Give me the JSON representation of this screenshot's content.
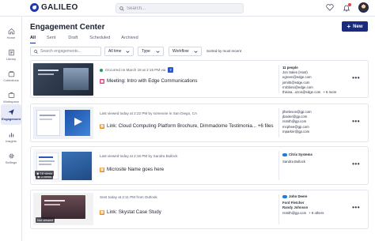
{
  "app": {
    "name": "GALILEO"
  },
  "search": {
    "placeholder": "Search..."
  },
  "page": {
    "title": "Engagement Center",
    "new_button": "New"
  },
  "tabs": [
    "All",
    "Sent",
    "Draft",
    "Scheduled",
    "Archived"
  ],
  "filters": {
    "search_placeholder": "Search engagements...",
    "time": "All time",
    "type": "Type",
    "workflow": "Workflow",
    "sort": "Sorted by most recent"
  },
  "sidebar": {
    "items": [
      {
        "label": "Home",
        "icon": "home-icon"
      },
      {
        "label": "Library",
        "icon": "library-icon"
      },
      {
        "label": "Collections",
        "icon": "collections-icon"
      },
      {
        "label": "Workspace",
        "icon": "workspace-icon"
      },
      {
        "label": "Engagement",
        "icon": "engagement-icon",
        "active": true
      },
      {
        "label": "Insights",
        "icon": "insights-icon"
      },
      {
        "label": "Settings",
        "icon": "settings-icon"
      }
    ]
  },
  "engagements": [
    {
      "status": "Occurred on March 18 at 2:15 PM via",
      "title": "Meeting: Intro with Edge Communications",
      "type_icon": "meeting-icon",
      "views": "",
      "people_head": "11 people",
      "people": [
        "Jon Sales (Host)",
        "egreen@edge.com",
        "jsmith@edge.com",
        "rrobbins@edge.com",
        "thisisa...ozon@edge.com"
      ],
      "people_more": "+ 6 more",
      "company": ""
    },
    {
      "status": "Last viewed today at 2:22 PM by someone in San Diego, CA",
      "title": "Link: Cloud Computing Platform Brochure, Dimmadome Testimonia... +6 files",
      "type_icon": "link-icon",
      "views": "",
      "people_head": "",
      "people": [
        "jthieleson@gp.com",
        "jbaxter@gp.com",
        "rsmith@gp.com",
        "mcphee@gp.com",
        "mparker@gp.com"
      ],
      "people_more": "",
      "company": ""
    },
    {
      "status": "Last viewed today at 2:16 PM by Sandra Bullock",
      "title": "Microsite Name goes here",
      "type_icon": "link-icon",
      "views": "3 views",
      "people_head": "",
      "people": [
        "Sandra Bullock"
      ],
      "people_more": "",
      "company": "Citrix Systems"
    },
    {
      "status": "Sent today at 2:11 PM from Outlook",
      "title": "Link: Skystat Case Study",
      "type_icon": "link-icon",
      "views": "Not viewed",
      "people_head": "",
      "people": [
        "Ford Fletcher",
        "Randy Johnson",
        "rsmith@gp.com"
      ],
      "people_more": "+ 6 others",
      "company": "John Deere"
    }
  ],
  "card_extra_views": "16 views",
  "colors": {
    "accent": "#1a2a7c",
    "occurred": "#1f9d55",
    "meeting": "#e0407c",
    "link": "#e58a1c"
  }
}
